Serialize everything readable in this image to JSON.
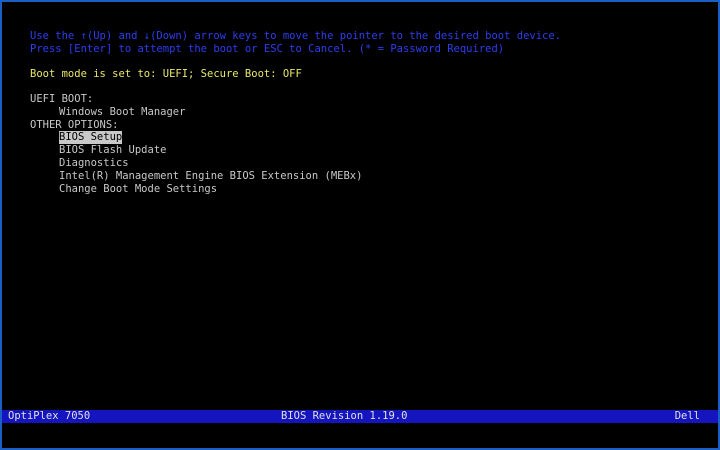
{
  "instructions": {
    "line1": "Use the ↑(Up) and ↓(Down) arrow keys to move the pointer to the desired boot device.",
    "line2": "Press [Enter] to attempt the boot or ESC to Cancel. (* = Password Required)"
  },
  "boot_mode": "Boot mode is set to: UEFI; Secure Boot: OFF",
  "uefi_boot": {
    "header": "UEFI BOOT:",
    "items": [
      "Windows Boot Manager"
    ]
  },
  "other_options": {
    "header": "OTHER OPTIONS:",
    "items": [
      "BIOS Setup",
      "BIOS Flash Update",
      "Diagnostics",
      "Intel(R) Management Engine BIOS Extension (MEBx)",
      "Change Boot Mode Settings"
    ],
    "selected_index": 0
  },
  "footer": {
    "model": "OptiPlex 7050",
    "bios_revision": "BIOS Revision 1.19.0",
    "vendor": "Dell"
  },
  "colors": {
    "instruction_text": "#2c3ef0",
    "boot_mode_text": "#e8e86a",
    "menu_text": "#c8c8c8",
    "footer_bg": "#1515c0",
    "border": "#1c5fc4"
  }
}
